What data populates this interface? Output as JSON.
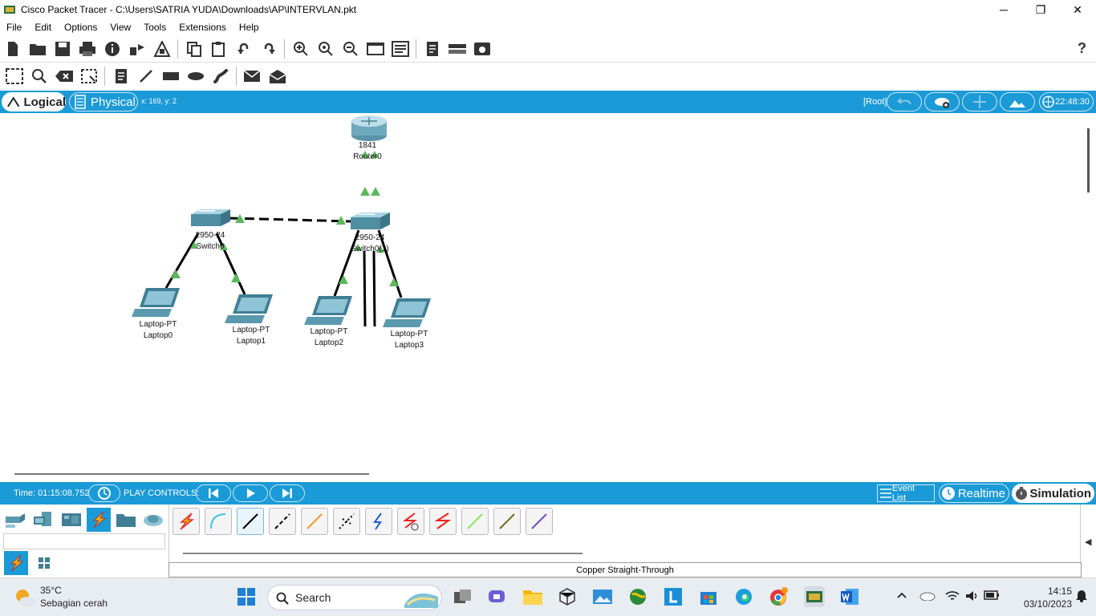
{
  "window": {
    "title": "Cisco Packet Tracer - C:\\Users\\SATRIA YUDA\\Downloads\\AP\\INTERVLAN.pkt",
    "minimize": "─",
    "maximize": "❐",
    "close": "✕"
  },
  "menu": [
    "File",
    "Edit",
    "Options",
    "View",
    "Tools",
    "Extensions",
    "Help"
  ],
  "help": "?",
  "workspace_bar": {
    "logical": "Logical",
    "physical": "Physical",
    "coords": "x: 169, y: 2",
    "root": "[Root]",
    "clock": "22:48:30"
  },
  "devices": [
    {
      "model": "1841",
      "name": "Router0"
    },
    {
      "model": "2950-24",
      "name": "Switch0"
    },
    {
      "model": "2950-24",
      "name": "Switch0(1)"
    },
    {
      "model": "Laptop-PT",
      "name": "Laptop0"
    },
    {
      "model": "Laptop-PT",
      "name": "Laptop1"
    },
    {
      "model": "Laptop-PT",
      "name": "Laptop2"
    },
    {
      "model": "Laptop-PT",
      "name": "Laptop3"
    }
  ],
  "sim": {
    "time": "Time: 01:15:08.752",
    "play_controls": "PLAY CONTROLS:",
    "event_list": "Event List",
    "realtime": "Realtime",
    "simulation": "Simulation"
  },
  "cable_panel": {
    "selected_name": "Copper Straight-Through",
    "right_arrow": "◀"
  },
  "taskbar": {
    "temp": "35°C",
    "weather": "Sebagian cerah",
    "search": "Search",
    "time": "14:15",
    "date": "03/10/2023"
  },
  "colors": {
    "accent": "#1a9ad6",
    "link_up": "#5cb85c",
    "taskbar": "#e8edf2"
  }
}
